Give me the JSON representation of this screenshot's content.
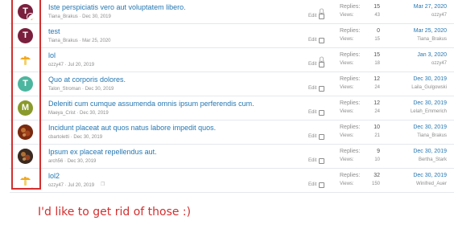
{
  "labels": {
    "replies": "Replies:",
    "views": "Views:",
    "edit": "Edit"
  },
  "rows": [
    {
      "title": "Iste perspiciatis vero aut voluptatem libero.",
      "author": "Tiana_Brakus",
      "date": "Dec 30, 2019",
      "replies": "15",
      "views": "43",
      "last_date": "Mar 27, 2020",
      "last_user": "ozzy47",
      "avatar_letter": "T",
      "avatar_color": "#7a1f3d",
      "mini": true,
      "bell": true
    },
    {
      "title": "test",
      "author": "Tiana_Brakus",
      "date": "Mar 25, 2020",
      "replies": "0",
      "views": "15",
      "last_date": "Mar 25, 2020",
      "last_user": "Tiana_Brakus",
      "avatar_letter": "T",
      "avatar_color": "#7a1f3d",
      "mini": false,
      "bell": false
    },
    {
      "title": "lol",
      "author": "ozzy47",
      "date": "Jul 20, 2019",
      "replies": "15",
      "views": "18",
      "last_date": "Jan 3, 2020",
      "last_user": "ozzy47",
      "avatar_letter": "",
      "avatar_color": "#ffffff",
      "mini": false,
      "bell": true
    },
    {
      "title": "Quo at corporis dolores.",
      "author": "Talon_Stroman",
      "date": "Dec 30, 2019",
      "replies": "12",
      "views": "24",
      "last_date": "Dec 30, 2019",
      "last_user": "Laila_Gulgowski",
      "avatar_letter": "T",
      "avatar_color": "#4cb69f",
      "mini": false,
      "bell": false
    },
    {
      "title": "Deleniti cum cumque assumenda omnis ipsum perferendis cum.",
      "author": "Maeya_Crist",
      "date": "Dec 30, 2019",
      "replies": "12",
      "views": "24",
      "last_date": "Dec 30, 2019",
      "last_user": "Lelah_Emmerich",
      "avatar_letter": "M",
      "avatar_color": "#8a9a2b",
      "mini": false,
      "bell": false
    },
    {
      "title": "Incidunt placeat aut quos natus labore impedit quos.",
      "author": "cbartoletti",
      "date": "Dec 30, 2019",
      "replies": "10",
      "views": "21",
      "last_date": "Dec 30, 2019",
      "last_user": "Tiana_Brakus",
      "avatar_letter": "",
      "avatar_color": "#7a2a10",
      "mini": false,
      "bell": false
    },
    {
      "title": "Ipsum ex placeat repellendus aut.",
      "author": "arch56",
      "date": "Dec 30, 2019",
      "replies": "9",
      "views": "10",
      "last_date": "Dec 30, 2019",
      "last_user": "Bertha_Stark",
      "avatar_letter": "",
      "avatar_color": "#3a2a20",
      "mini": false,
      "bell": false
    },
    {
      "title": "lol2",
      "author": "ozzy47",
      "date": "Jul 20, 2019",
      "replies": "32",
      "views": "150",
      "last_date": "Dec 30, 2019",
      "last_user": "Winifred_Auer",
      "avatar_letter": "",
      "avatar_color": "#ffffff",
      "mini": true,
      "bell": false
    }
  ],
  "note": "I'd like to get rid of those :)",
  "colors": {
    "link": "#2577b1",
    "annotation": "#d32f2f"
  }
}
